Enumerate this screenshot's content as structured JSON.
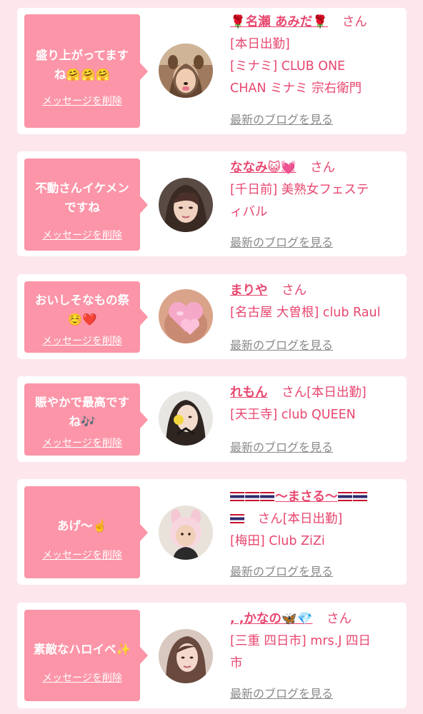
{
  "delete_label": "メッセージを削除",
  "blog_label": "最新のブログを見る",
  "san_label": "さん",
  "colors": {
    "page_bg": "#fde7ec",
    "bubble": "#fc95a8",
    "accent_text": "#e8476f",
    "link_gray": "#8a8a8a"
  },
  "entries": [
    {
      "message_lines": [
        "盛り上がってます",
        "ね🤗🤗🤗"
      ],
      "name": "🌹名瀬 あみだ🌹",
      "tag": "[本日出勤]",
      "shop_lines": [
        "[ミナミ] CLUB ONE",
        "CHAN ミナミ 宗右衛門"
      ],
      "avatar_icon": "avatar-woman-dog-filter-icon"
    },
    {
      "message_lines": [
        "不動さんイケメン",
        "ですね"
      ],
      "name": "ななみ😺💓",
      "tag": "",
      "shop_lines": [
        "[千日前] 美熟女フェステ",
        "ィバル"
      ],
      "avatar_icon": "avatar-woman-portrait-icon"
    },
    {
      "message_lines": [
        "おいしそなもの祭",
        "☺️❤️"
      ],
      "name": "まりや",
      "tag": "",
      "shop_lines": [
        "[名古屋 大曽根] club Raul"
      ],
      "avatar_icon": "avatar-pink-hearts-icon"
    },
    {
      "message_lines": [
        "賑やかで最高です",
        "ね🎶"
      ],
      "name": "れもん",
      "tag": "[本日出勤]",
      "shop_lines": [
        "[天王寺] club QUEEN"
      ],
      "avatar_icon": "avatar-woman-lemon-icon"
    },
    {
      "message_lines": [
        "あげ〜☝️"
      ],
      "name": "〜まさる〜",
      "tag": "[本日出勤]",
      "shop_lines": [
        "[梅田] Club ZiZi"
      ],
      "avatar_icon": "avatar-pig-hood-icon"
    },
    {
      "message_lines": [
        "素敵なハロイベ✨"
      ],
      "name": ", ,かなの🦋💎",
      "tag": "",
      "shop_lines": [
        "[三重 四日市] mrs.J 四日",
        "市"
      ],
      "avatar_icon": "avatar-woman-long-hair-icon"
    }
  ]
}
